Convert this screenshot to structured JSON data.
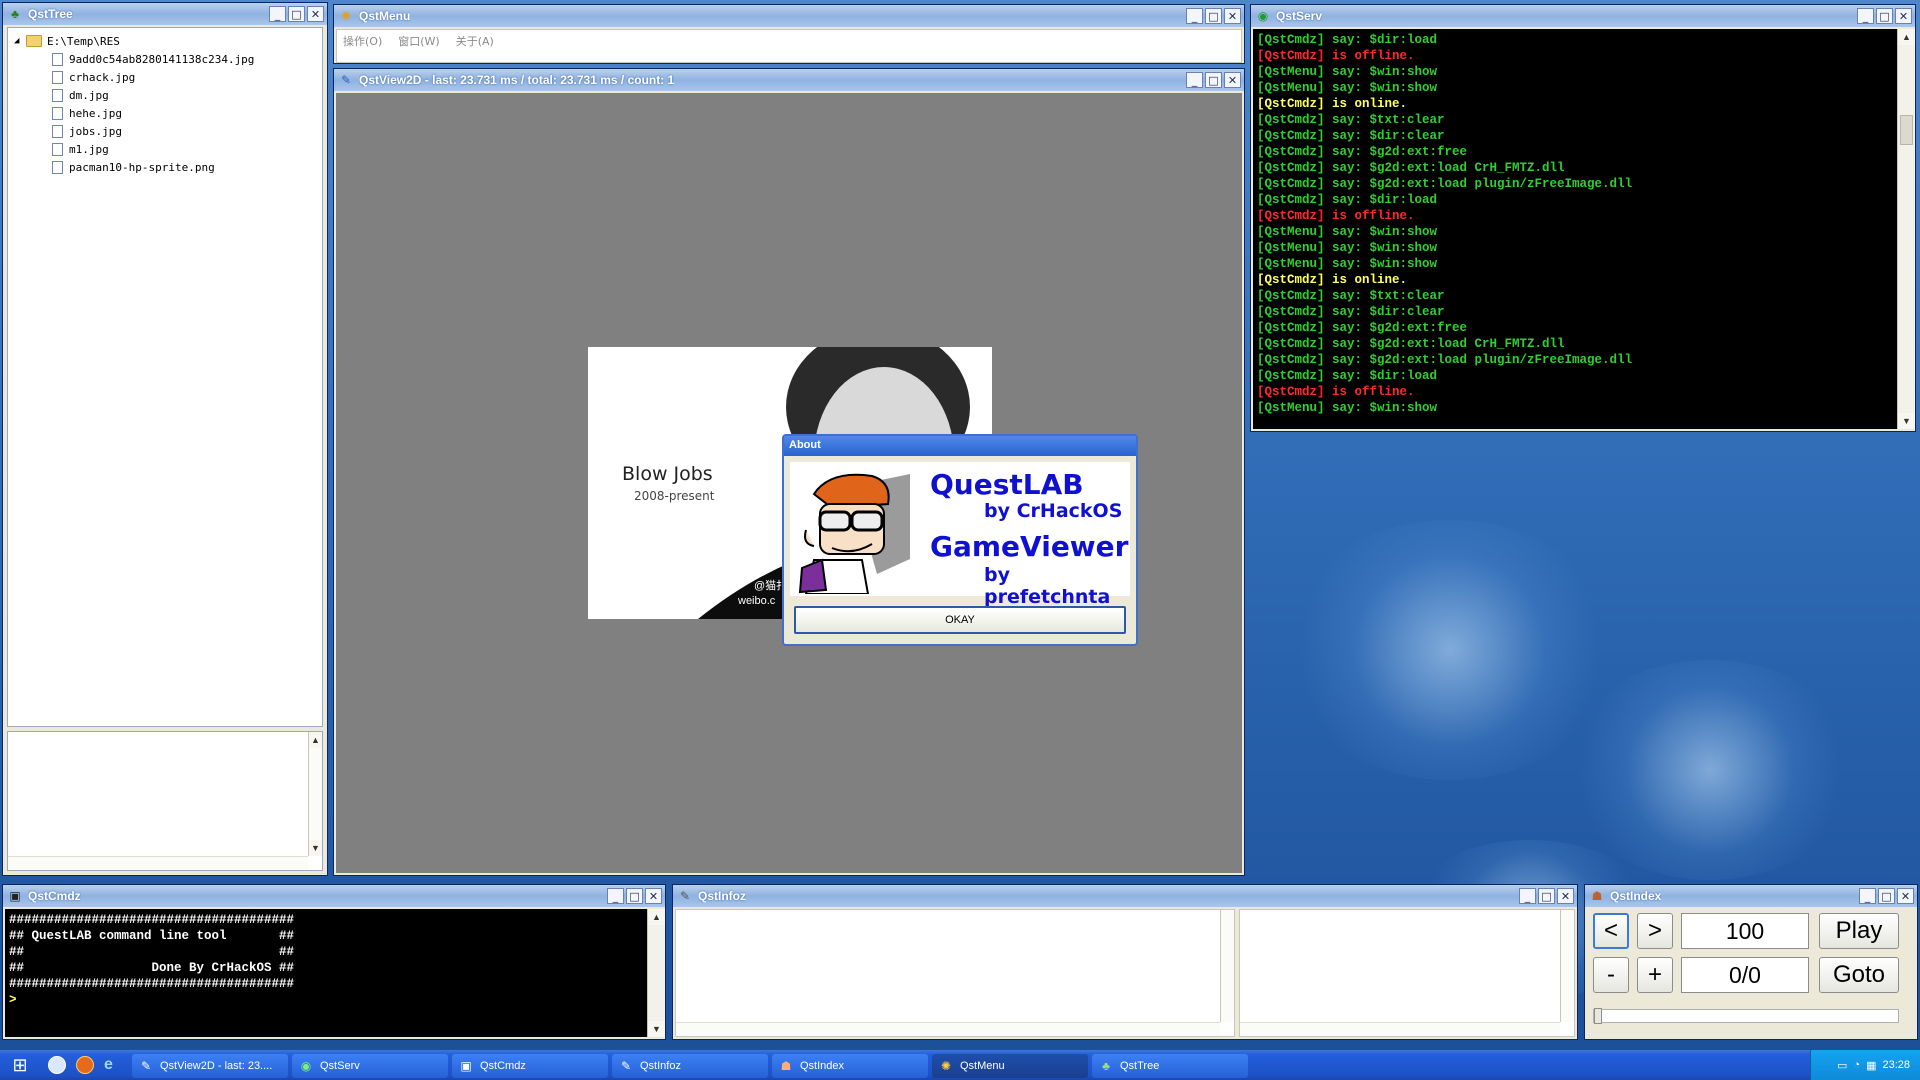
{
  "qsttree": {
    "title": "QstTree",
    "root": "E:\\Temp\\RES",
    "files": [
      "9add0c54ab8280141138c234.jpg",
      "crhack.jpg",
      "dm.jpg",
      "hehe.jpg",
      "jobs.jpg",
      "m1.jpg",
      "pacman10-hp-sprite.png"
    ]
  },
  "qstmenu": {
    "title": "QstMenu",
    "menu": [
      "操作(O)",
      "窗口(W)",
      "关于(A)"
    ]
  },
  "qstview": {
    "title": "QstView2D - last: 23.731 ms / total: 23.731 ms / count: 1",
    "image_caption": "Blow Jobs",
    "image_subcaption": "2008-present",
    "image_watermark1": "@猫扑",
    "image_watermark2": "weibo.c"
  },
  "about": {
    "title": "About",
    "app1": "QuestLAB",
    "by1": "by CrHackOS",
    "app2": "GameViewer",
    "by2": "by prefetchnta",
    "ok": "OKAY"
  },
  "qstserv": {
    "title": "QstServ",
    "lines": [
      {
        "tag": "[QstCmdz]",
        "text": " say: $dir:load",
        "color": "green"
      },
      {
        "tag": "[QstCmdz]",
        "text": " is offline.",
        "color": "red"
      },
      {
        "tag": "[QstMenu]",
        "text": " say: $win:show",
        "color": "green"
      },
      {
        "tag": "[QstMenu]",
        "text": " say: $win:show",
        "color": "green"
      },
      {
        "tag": "[QstCmdz]",
        "text": " is online.",
        "color": "yellow"
      },
      {
        "tag": "[QstCmdz]",
        "text": " say: $txt:clear",
        "color": "green"
      },
      {
        "tag": "[QstCmdz]",
        "text": " say: $dir:clear",
        "color": "green"
      },
      {
        "tag": "[QstCmdz]",
        "text": " say: $g2d:ext:free",
        "color": "green"
      },
      {
        "tag": "[QstCmdz]",
        "text": " say: $g2d:ext:load CrH_FMTZ.dll",
        "color": "green"
      },
      {
        "tag": "[QstCmdz]",
        "text": " say: $g2d:ext:load plugin/zFreeImage.dll",
        "color": "green"
      },
      {
        "tag": "[QstCmdz]",
        "text": " say: $dir:load",
        "color": "green"
      },
      {
        "tag": "[QstCmdz]",
        "text": " is offline.",
        "color": "red"
      },
      {
        "tag": "[QstMenu]",
        "text": " say: $win:show",
        "color": "green"
      },
      {
        "tag": "[QstMenu]",
        "text": " say: $win:show",
        "color": "green"
      },
      {
        "tag": "[QstMenu]",
        "text": " say: $win:show",
        "color": "green"
      },
      {
        "tag": "[QstCmdz]",
        "text": " is online.",
        "color": "yellow"
      },
      {
        "tag": "[QstCmdz]",
        "text": " say: $txt:clear",
        "color": "green"
      },
      {
        "tag": "[QstCmdz]",
        "text": " say: $dir:clear",
        "color": "green"
      },
      {
        "tag": "[QstCmdz]",
        "text": " say: $g2d:ext:free",
        "color": "green"
      },
      {
        "tag": "[QstCmdz]",
        "text": " say: $g2d:ext:load CrH_FMTZ.dll",
        "color": "green"
      },
      {
        "tag": "[QstCmdz]",
        "text": " say: $g2d:ext:load plugin/zFreeImage.dll",
        "color": "green"
      },
      {
        "tag": "[QstCmdz]",
        "text": " say: $dir:load",
        "color": "green"
      },
      {
        "tag": "[QstCmdz]",
        "text": " is offline.",
        "color": "red"
      },
      {
        "tag": "[QstMenu]",
        "text": " say: $win:show",
        "color": "green"
      }
    ]
  },
  "qstcmdz": {
    "title": "QstCmdz",
    "lines": [
      "######################################",
      "## QuestLAB command line tool       ##",
      "##                                  ##",
      "##                 Done By CrHackOS ##",
      "######################################"
    ],
    "prompt": ">"
  },
  "qstinfoz": {
    "title": "QstInfoz"
  },
  "qstindex": {
    "title": "QstIndex",
    "prev": "<",
    "next": ">",
    "value": "100",
    "play": "Play",
    "minus": "-",
    "plus": "+",
    "position": "0/0",
    "goto": "Goto"
  },
  "taskbar": {
    "tasks": [
      "QstView2D - last: 23....",
      "QstServ",
      "QstCmdz",
      "QstInfoz",
      "QstIndex",
      "QstMenu",
      "QstTree"
    ],
    "clock": "23:28"
  },
  "colors": {
    "green": "#2fd02f",
    "red": "#ff2a2a",
    "yellow": "#ffff66",
    "about_text": "#1010d0"
  }
}
